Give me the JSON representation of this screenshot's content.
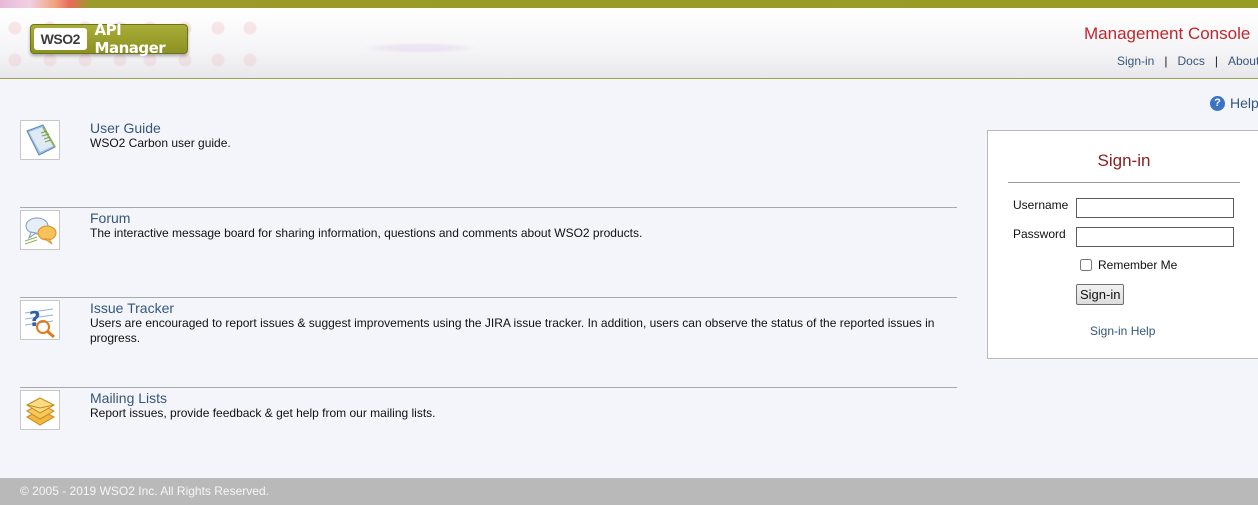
{
  "header": {
    "logo_brand": "WSO2",
    "logo_product": "API Manager",
    "console_title": "Management Console",
    "links": [
      {
        "label": "Sign-in"
      },
      {
        "label": "Docs"
      },
      {
        "label": "About"
      }
    ]
  },
  "help": {
    "label": "Help"
  },
  "resources": [
    {
      "title": "User Guide",
      "description": "WSO2 Carbon user guide.",
      "icon": "user-guide-icon"
    },
    {
      "title": "Forum",
      "description": "The interactive message board for sharing information, questions and comments about WSO2 products.",
      "icon": "forum-icon"
    },
    {
      "title": "Issue Tracker",
      "description": "Users are encouraged to report issues & suggest improvements using the JIRA issue tracker. In addition, users can observe the status of the reported issues in progress.",
      "icon": "issue-tracker-icon"
    },
    {
      "title": "Mailing Lists",
      "description": "Report issues, provide feedback & get help from our mailing lists.",
      "icon": "mailing-lists-icon"
    }
  ],
  "login": {
    "title": "Sign-in",
    "username_label": "Username",
    "username_value": "",
    "password_label": "Password",
    "password_value": "",
    "remember_label": "Remember Me",
    "remember_checked": false,
    "submit_label": "Sign-in",
    "help_link": "Sign-in Help"
  },
  "footer": {
    "copyright": "© 2005 - 2019 WSO2 Inc. All Rights Reserved."
  },
  "colors": {
    "accent_olive": "#979c24",
    "link_blue": "#35567a",
    "title_red": "#c0262e",
    "signin_title": "#8a1f24",
    "footer_gray": "#b9b9b9"
  }
}
